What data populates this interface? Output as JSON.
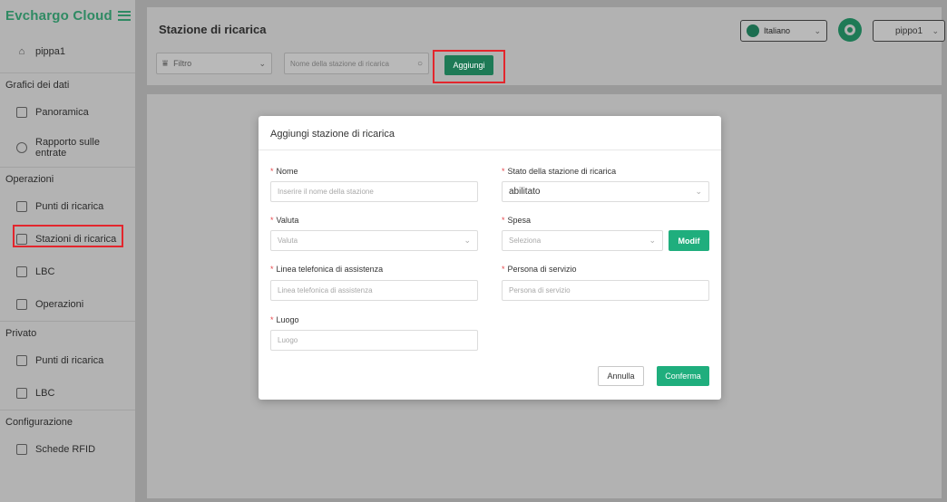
{
  "app": {
    "logo": "Evchargo Cloud"
  },
  "sidebar": {
    "user": "pippa1",
    "groups": [
      {
        "label": "Grafici dei dati",
        "items": [
          {
            "label": "Panoramica",
            "icon": "chart-icon"
          },
          {
            "label": "Rapporto sulle entrate",
            "icon": "clock-icon"
          }
        ]
      },
      {
        "label": "Operazioni",
        "items": [
          {
            "label": "Punti di ricarica",
            "icon": "charger-icon"
          },
          {
            "label": "Stazioni di ricarica",
            "icon": "station-icon"
          },
          {
            "label": "LBC",
            "icon": "database-icon"
          },
          {
            "label": "Operazioni",
            "icon": "list-icon"
          }
        ]
      },
      {
        "label": "Privato",
        "items": [
          {
            "label": "Punti di ricarica",
            "icon": "charger-icon"
          },
          {
            "label": "LBC",
            "icon": "database-icon"
          }
        ]
      },
      {
        "label": "Configurazione",
        "items": [
          {
            "label": "Schede RFID",
            "icon": "card-icon"
          }
        ]
      }
    ]
  },
  "header": {
    "title": "Stazione di ricarica",
    "filter_label": "Filtro",
    "search_placeholder": "Nome della stazione di ricarica",
    "add_label": "Aggiungi",
    "language": "Italiano",
    "username": "pippo1"
  },
  "modal": {
    "title": "Aggiungi stazione di ricarica",
    "fields": {
      "nome": {
        "label": "Nome",
        "placeholder": "Inserire il nome della stazione"
      },
      "stato": {
        "label": "Stato della stazione di ricarica",
        "value": "abilitato"
      },
      "valuta": {
        "label": "Valuta",
        "placeholder": "Valuta"
      },
      "spesa": {
        "label": "Spesa",
        "placeholder": "Seleziona",
        "modify_label": "Modif"
      },
      "linea": {
        "label": "Linea telefonica di assistenza",
        "placeholder": "Linea telefonica di assistenza"
      },
      "persona": {
        "label": "Persona di servizio",
        "placeholder": "Persona di servizio"
      },
      "luogo": {
        "label": "Luogo",
        "placeholder": "Luogo"
      }
    },
    "cancel_label": "Annulla",
    "confirm_label": "Conferma"
  },
  "colors": {
    "brand": "#1fae7d",
    "highlight": "#e3262d",
    "required": "#e5484d"
  }
}
